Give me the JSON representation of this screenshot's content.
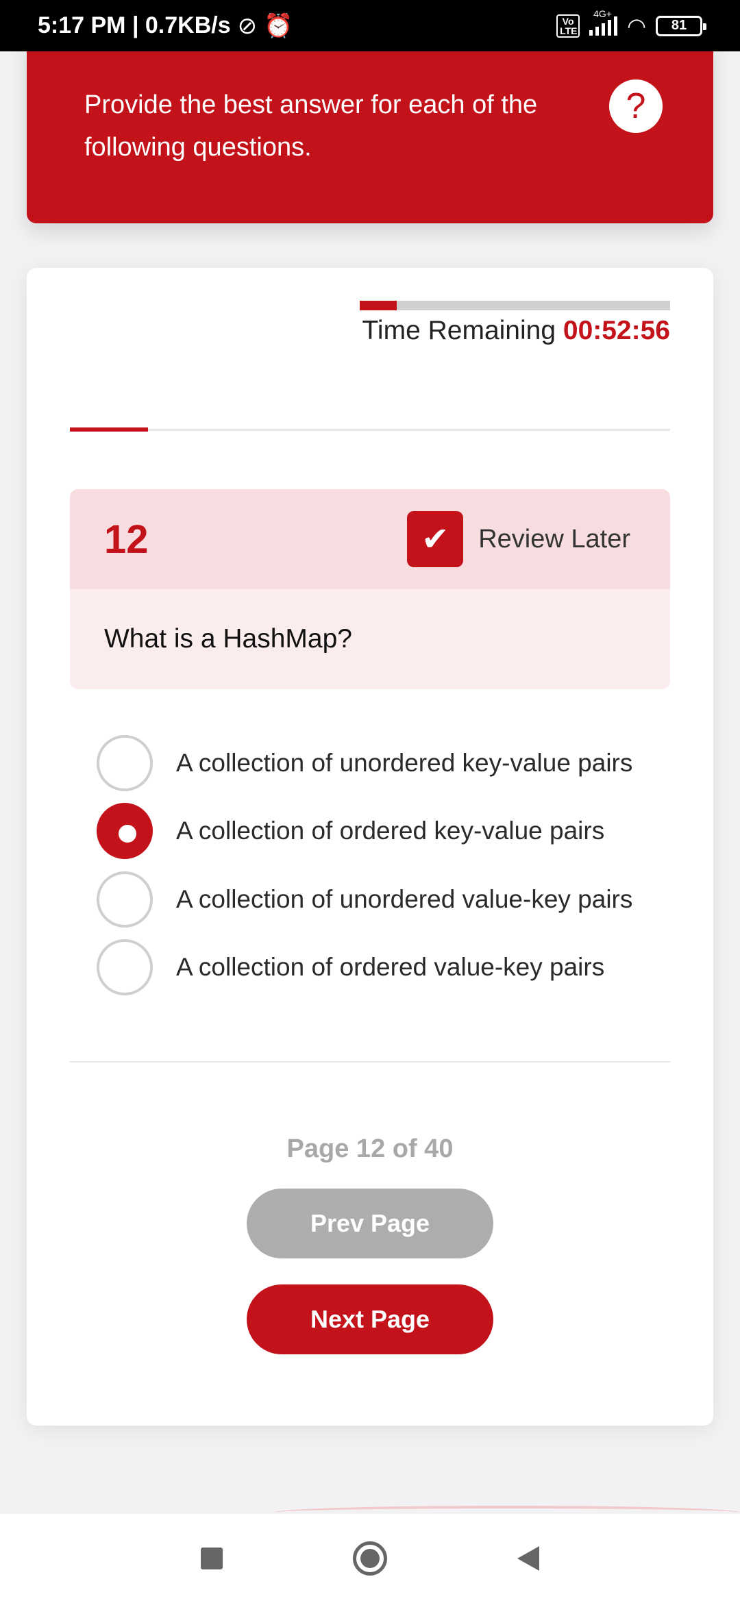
{
  "status_bar": {
    "time_speed": "5:17 PM | 0.7KB/s",
    "network_label": "4G+",
    "volte_label": "Vo LTE",
    "battery_level": "81"
  },
  "header": {
    "instruction": "Provide the best answer for each of the following questions.",
    "help_label": "?"
  },
  "timer": {
    "label": "Time Remaining",
    "value": "00:52:56",
    "elapsed_fraction": 0.12
  },
  "question_progress_fraction": 0.13,
  "question": {
    "number": "12",
    "review_label": "Review Later",
    "review_checked": true,
    "text": "What is a HashMap?"
  },
  "options": [
    {
      "label": "A collection of unordered key-value pairs",
      "selected": false
    },
    {
      "label": "A collection of ordered key-value pairs",
      "selected": true
    },
    {
      "label": "A collection of unordered value-key pairs",
      "selected": false
    },
    {
      "label": "A collection of ordered value-key pairs",
      "selected": false
    }
  ],
  "pagination": {
    "indicator": "Page 12 of 40",
    "prev_label": "Prev Page",
    "next_label": "Next Page"
  },
  "colors": {
    "accent": "#c4121a",
    "disabled": "#adadad"
  }
}
